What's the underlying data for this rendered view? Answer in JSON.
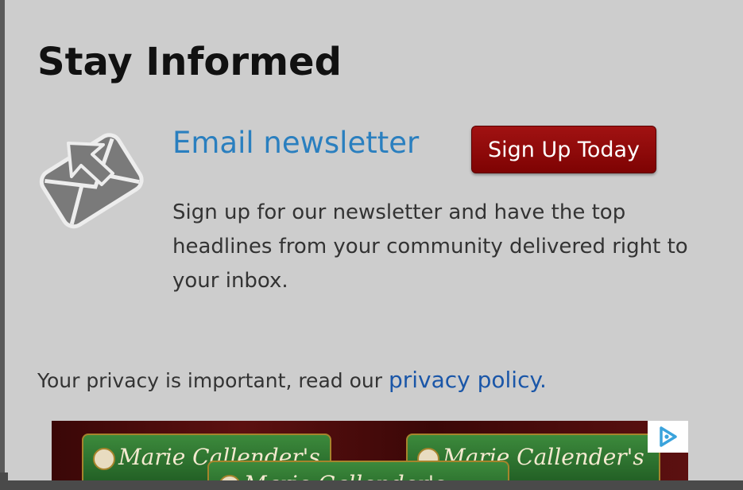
{
  "section": {
    "title": "Stay Informed"
  },
  "newsletter": {
    "link_label": "Email newsletter",
    "signup_label": "Sign Up Today",
    "description": "Sign up for our newsletter and have the top headlines from your community delivered right to your inbox.",
    "icon": "envelope-icon"
  },
  "privacy": {
    "text": "Your privacy is important, read our",
    "link_label": "privacy policy."
  },
  "ad": {
    "brand_text": "Marie Callender's",
    "adchoices_icon": "adchoices-icon"
  },
  "colors": {
    "background": "#cdcdcd",
    "link": "#2a7fbf",
    "button": "#8b0a0a",
    "ad_green": "#2e7a30"
  }
}
